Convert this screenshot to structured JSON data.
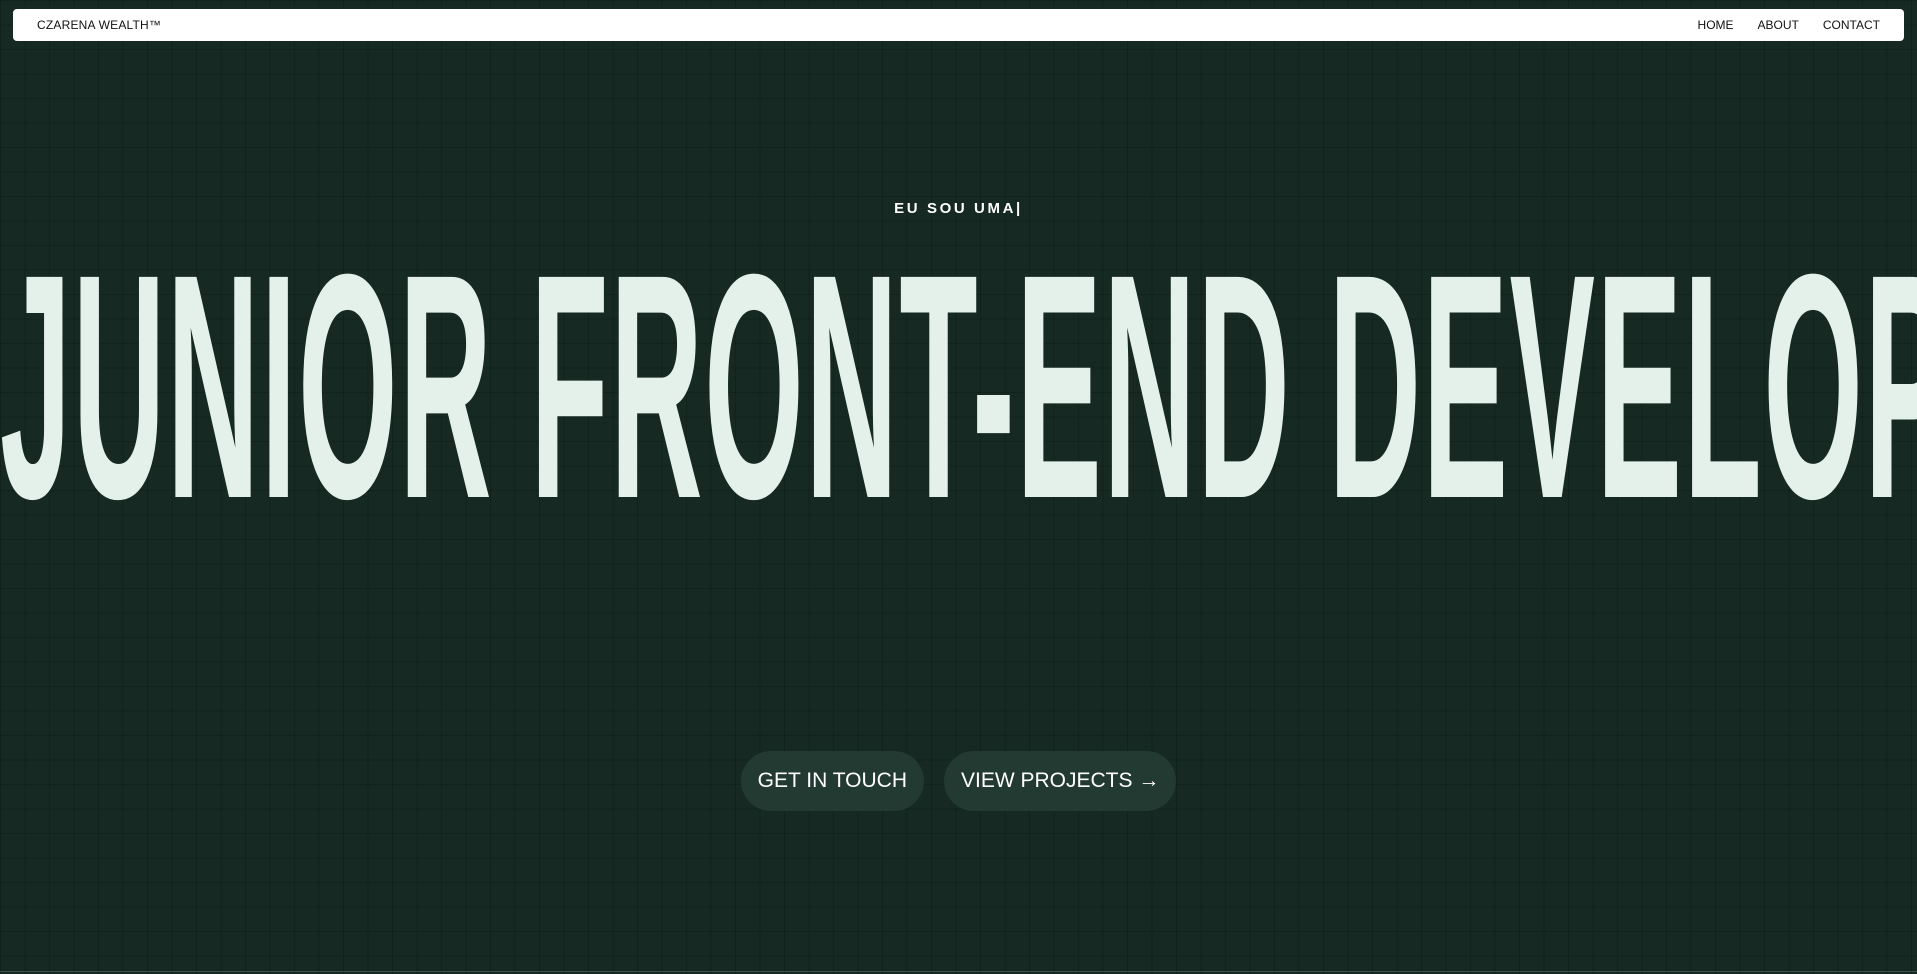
{
  "navbar": {
    "brand": "CZARENA WEALTH™",
    "links": [
      {
        "label": "HOME"
      },
      {
        "label": "ABOUT"
      },
      {
        "label": "CONTACT"
      }
    ]
  },
  "hero": {
    "typed_text": "EU SOU UMA|",
    "headline": "JUNIOR FRONT-END DEVELOPER"
  },
  "cta": {
    "get_in_touch": "GET IN TOUCH",
    "view_projects": "VIEW PROJECTS →"
  },
  "colors": {
    "background": "#162922",
    "headline": "#e4f1ea",
    "pill": "#223a31",
    "navbar": "#ffffff"
  }
}
